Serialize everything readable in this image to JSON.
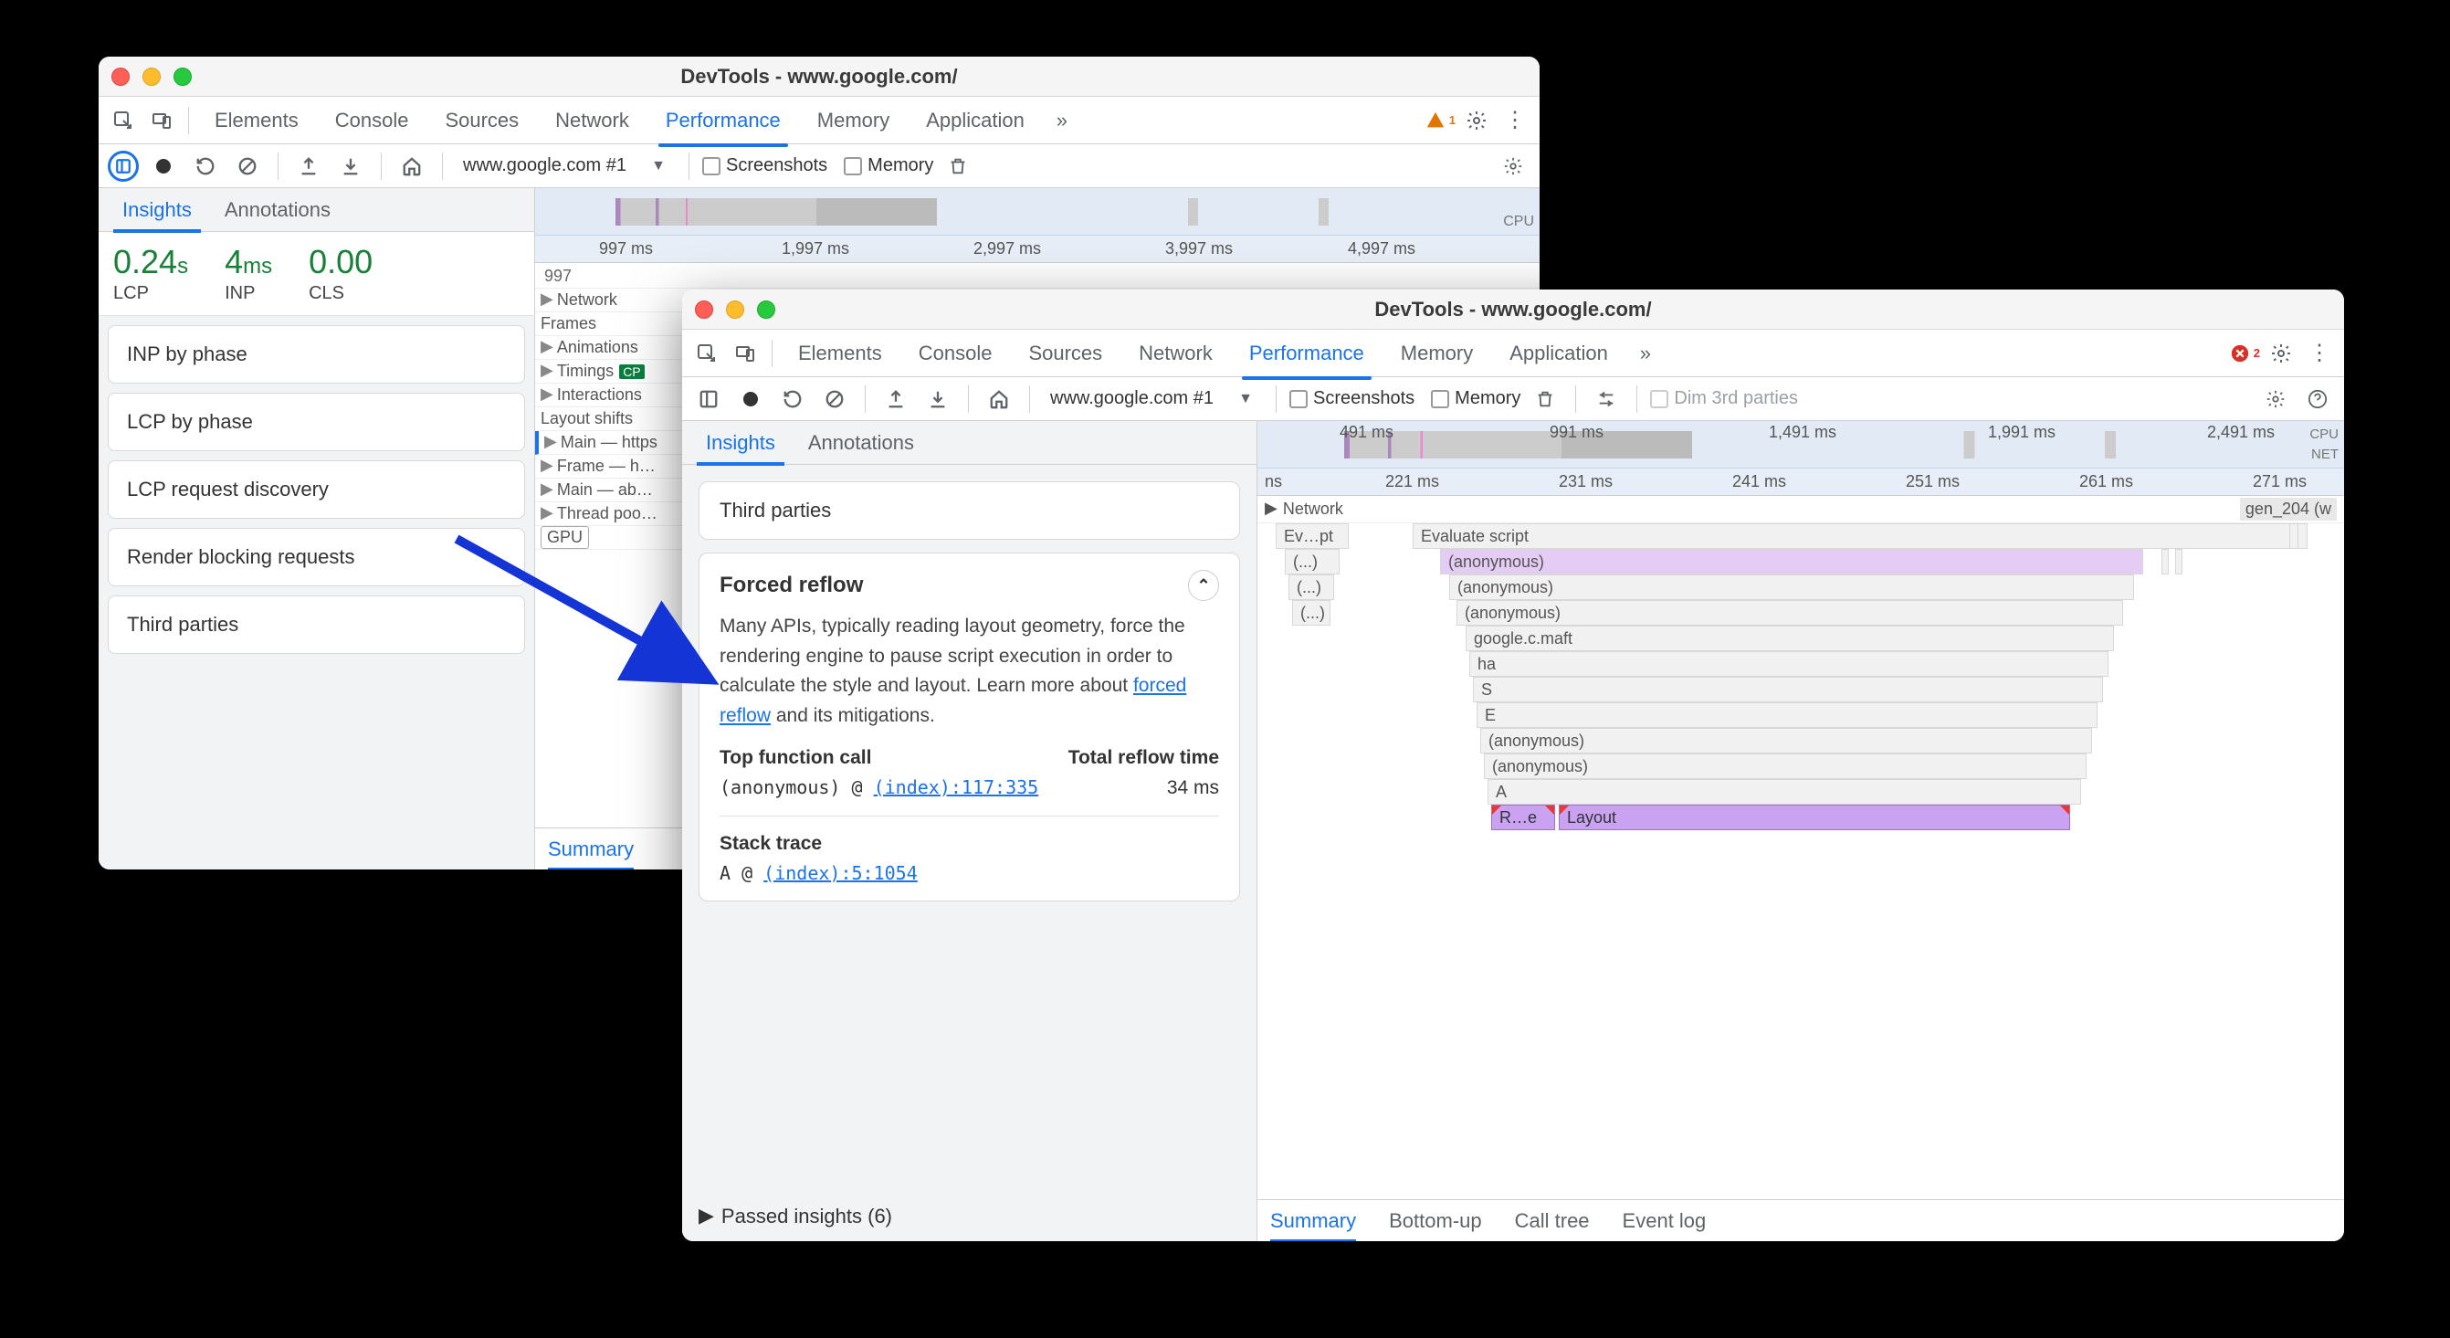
{
  "back": {
    "title": "DevTools - www.google.com/",
    "tabs": [
      "Elements",
      "Console",
      "Sources",
      "Network",
      "Performance",
      "Memory",
      "Application"
    ],
    "activeTab": "Performance",
    "warnCount": "1",
    "toolbar": {
      "targetLabel": "www.google.com #1",
      "screenshots": "Screenshots",
      "memory": "Memory"
    },
    "subtabs": {
      "insights": "Insights",
      "annotations": "Annotations"
    },
    "activeSubtab": "Insights",
    "metrics": [
      {
        "val": "0.24",
        "unit": "s",
        "label": "LCP"
      },
      {
        "val": "4",
        "unit": "ms",
        "label": "INP"
      },
      {
        "val": "0.00",
        "unit": "",
        "label": "CLS"
      }
    ],
    "insightCards": [
      "INP by phase",
      "LCP by phase",
      "LCP request discovery",
      "Render blocking requests",
      "Third parties"
    ],
    "ruler": [
      "997 ms",
      "1,997 ms",
      "2,997 ms",
      "3,997 ms",
      "4,997 ms"
    ],
    "ruler2label": "997",
    "cpuLabel": "CPU",
    "tracks": [
      "Network",
      "Frames",
      "Animations",
      "Timings",
      "Interactions",
      "Layout shifts",
      "Main — https",
      "Frame — h…",
      "Main — ab…",
      "Thread poo…",
      "GPU"
    ],
    "timingsBadge": "CP",
    "summary": "Summary"
  },
  "front": {
    "title": "DevTools - www.google.com/",
    "tabs": [
      "Elements",
      "Console",
      "Sources",
      "Network",
      "Performance",
      "Memory",
      "Application"
    ],
    "activeTab": "Performance",
    "errCount": "2",
    "toolbar": {
      "targetLabel": "www.google.com #1",
      "screenshots": "Screenshots",
      "memory": "Memory",
      "dim": "Dim 3rd parties"
    },
    "subtabs": {
      "insights": "Insights",
      "annotations": "Annotations"
    },
    "activeSubtab": "Insights",
    "thirdCard": "Third parties",
    "reflow": {
      "title": "Forced reflow",
      "body_prefix": "Many APIs, typically reading layout geometry, force the rendering engine to pause script execution in order to calculate the style and layout. Learn more about ",
      "link": "forced reflow",
      "body_suffix": " and its mitigations.",
      "colTop": "Top function call",
      "colTotal": "Total reflow time",
      "fn": "(anonymous) @ ",
      "fnLink": "(index):117:335",
      "time": "34 ms",
      "stack": "Stack trace",
      "stEntry": "A @ ",
      "stLink": "(index):5:1054"
    },
    "passed": "Passed insights (6)",
    "miniRuler": [
      "491 ms",
      "991 ms",
      "1,491 ms",
      "1,991 ms",
      "2,491 ms"
    ],
    "cpuLabel": "CPU",
    "netLabel": "NET",
    "detailRuler": [
      "ns",
      "221 ms",
      "231 ms",
      "241 ms",
      "251 ms",
      "261 ms",
      "271 ms"
    ],
    "networkTrack": "Network",
    "networkRight": "gen_204 (w",
    "flame": {
      "eval": "Evaluate script",
      "evpt": "Ev…pt",
      "dots": "(...)",
      "rows": [
        "(anonymous)",
        "(anonymous)",
        "(anonymous)",
        "google.c.maft",
        "ha",
        "S",
        "E",
        "(anonymous)",
        "(anonymous)",
        "A"
      ],
      "re": "R…e",
      "layout": "Layout"
    },
    "bottomTabs": [
      "Summary",
      "Bottom-up",
      "Call tree",
      "Event log"
    ],
    "activeBottom": "Summary"
  }
}
